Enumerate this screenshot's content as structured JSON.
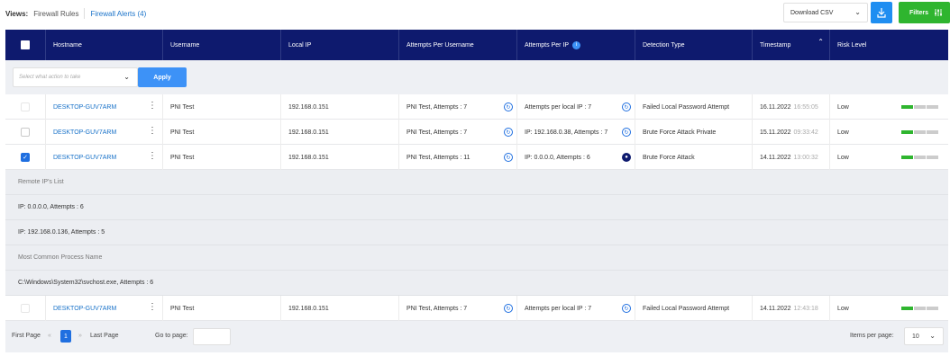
{
  "views": {
    "label": "Views:",
    "tabs": [
      {
        "label": "Firewall Rules"
      },
      {
        "label": "Firewall Alerts (4)"
      }
    ]
  },
  "toolbar": {
    "download_select": "Download CSV",
    "filters_label": "Filters"
  },
  "columns": [
    "Hostname",
    "Username",
    "Local IP",
    "Attempts Per Username",
    "Attempts Per IP",
    "Detection Type",
    "Timestamp",
    "Risk Level"
  ],
  "action_bar": {
    "placeholder": "Select what action to take",
    "apply_label": "Apply"
  },
  "rows": [
    {
      "hostname": "DESKTOP-GUV7ARM",
      "username": "PNI Test",
      "local_ip": "192.168.0.151",
      "attempts_user": "PNI Test, Attempts : 7",
      "attempts_ip": "Attempts per local IP : 7",
      "detection": "Failed Local Password Attempt",
      "date": "16.11.2022",
      "time": "16:55:05",
      "risk": "Low",
      "risk_level": 1,
      "checked": false
    },
    {
      "hostname": "DESKTOP-GUV7ARM",
      "username": "PNI Test",
      "local_ip": "192.168.0.151",
      "attempts_user": "PNI Test, Attempts : 7",
      "attempts_ip": "IP: 192.168.0.38, Attempts : 7",
      "detection": "Brute Force Attack Private",
      "date": "15.11.2022",
      "time": "09:33:42",
      "risk": "Low",
      "risk_level": 1,
      "checked": false
    },
    {
      "hostname": "DESKTOP-GUV7ARM",
      "username": "PNI Test",
      "local_ip": "192.168.0.151",
      "attempts_user": "PNI Test, Attempts : 11",
      "attempts_ip": "IP: 0.0.0.0, Attempts : 6",
      "detection": "Brute Force Attack",
      "date": "14.11.2022",
      "time": "13:00:32",
      "risk": "Low",
      "risk_level": 1,
      "checked": true
    },
    {
      "hostname": "DESKTOP-GUV7ARM",
      "username": "PNI Test",
      "local_ip": "192.168.0.151",
      "attempts_user": "PNI Test, Attempts : 7",
      "attempts_ip": "Attempts per local IP : 7",
      "detection": "Failed Local Password Attempt",
      "date": "14.11.2022",
      "time": "12:43:18",
      "risk": "Low",
      "risk_level": 1,
      "checked": false
    }
  ],
  "expanded": {
    "remote_ips_heading": "Remote IP's List",
    "remote_ips": [
      "IP: 0.0.0.0, Attempts : 6",
      "IP: 192.168.0.136, Attempts : 5"
    ],
    "process_heading": "Most Common Process Name",
    "process": "C:\\Windows\\System32\\svchost.exe, Attempts : 6"
  },
  "footer": {
    "first_page": "First Page",
    "current_page": "1",
    "last_page": "Last Page",
    "goto_label": "Go to page:",
    "per_page_label": "Items per page:",
    "per_page_value": "10"
  },
  "colors": {
    "header_bg": "#0e1a6e",
    "accent_blue": "#1f8ef1",
    "filters_green": "#2fb52f",
    "link": "#1a73c9"
  }
}
